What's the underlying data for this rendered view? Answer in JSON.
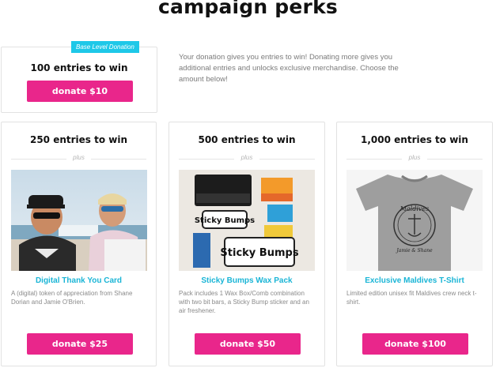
{
  "page": {
    "title": "campaign perks",
    "intro": "Your donation gives you entries to win! Donating more gives you additional entries and unlocks exclusive merchandise. Choose the amount below!"
  },
  "base_tier": {
    "badge": "Base Level Donation",
    "entries": "100 entries to win",
    "button": "donate $10"
  },
  "tiers": [
    {
      "entries": "250 entries to win",
      "plus": "plus",
      "perk_title": "Digital Thank You Card",
      "perk_desc": "A (digital) token of appreciation from Shane Dorian and Jamie O'Brien.",
      "button": "donate $25",
      "image": "two-surfers-photo"
    },
    {
      "entries": "500 entries to win",
      "plus": "plus",
      "perk_title": "Sticky Bumps Wax Pack",
      "perk_desc": "Pack includes 1 Wax Box/Comb combination with two bit bars, a Sticky Bump sticker and an air freshener.",
      "button": "donate $50",
      "image": "wax-pack-photo"
    },
    {
      "entries": "1,000 entries to win",
      "plus": "plus",
      "perk_title": "Exclusive Maldives T-Shirt",
      "perk_desc": "Limited edition unisex fit Maldives crew neck t-shirt.",
      "button": "donate $100",
      "image": "grey-tshirt-photo"
    }
  ],
  "image_text": {
    "wax_brand": "Sticky Bumps",
    "shirt_brand": "Maldives",
    "shirt_sub": "Jamie & Shane"
  },
  "colors": {
    "accent_pink": "#e9268b",
    "accent_cyan": "#1ec8e8",
    "perk_title": "#1ab5d6"
  }
}
